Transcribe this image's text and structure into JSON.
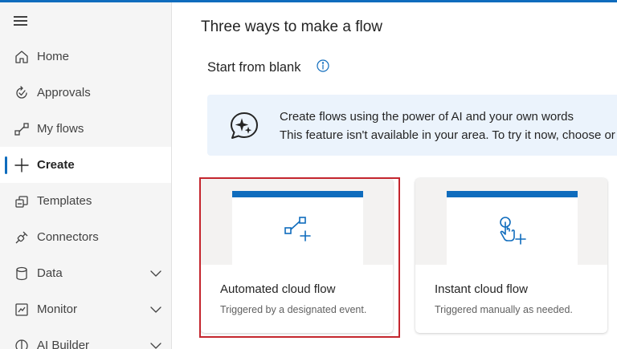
{
  "sidebar": {
    "items": [
      {
        "label": "Home",
        "icon": "home-icon"
      },
      {
        "label": "Approvals",
        "icon": "approvals-icon"
      },
      {
        "label": "My flows",
        "icon": "flow-icon"
      },
      {
        "label": "Create",
        "icon": "plus-icon",
        "active": true
      },
      {
        "label": "Templates",
        "icon": "templates-icon"
      },
      {
        "label": "Connectors",
        "icon": "connector-icon"
      },
      {
        "label": "Data",
        "icon": "database-icon",
        "expandable": true
      },
      {
        "label": "Monitor",
        "icon": "monitor-icon",
        "expandable": true
      },
      {
        "label": "AI Builder",
        "icon": "ai-builder-icon",
        "expandable": true
      }
    ]
  },
  "main": {
    "heading": "Three ways to make a flow",
    "subheading": "Start from blank",
    "banner": {
      "line1": "Create flows using the power of AI and your own words",
      "line2": "This feature isn't available in your area. To try it now, choose or"
    },
    "cards": [
      {
        "title": "Automated cloud flow",
        "description": "Triggered by a designated event.",
        "icon": "automated-flow-icon",
        "selected": true
      },
      {
        "title": "Instant cloud flow",
        "description": "Triggered manually as needed.",
        "icon": "touch-icon"
      }
    ]
  },
  "colors": {
    "accent": "#0f6cbd",
    "selection_outline": "#c4262e",
    "banner_bg": "#ebf3fc",
    "sidebar_bg": "#f5f5f5"
  }
}
